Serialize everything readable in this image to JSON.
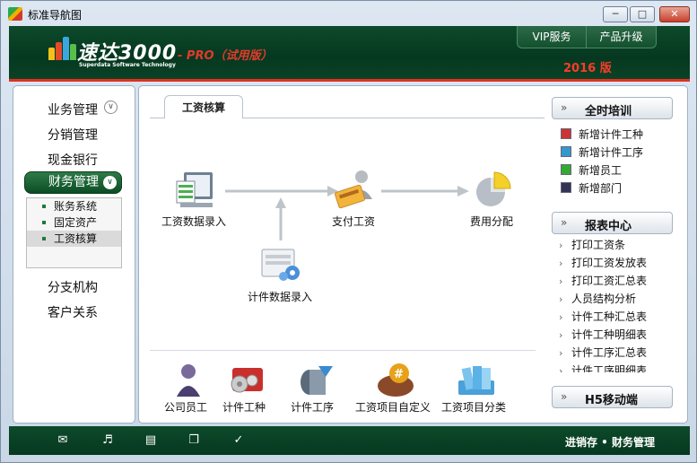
{
  "window": {
    "title": "标准导航图"
  },
  "header": {
    "logo_cn": "速达3000",
    "logo_sub": "Superdata Software Technology",
    "logo_pro": "- PRO（试用版）",
    "tabs": [
      "VIP服务",
      "产品升级"
    ],
    "year": "2016 版"
  },
  "sidebar": {
    "items_top": [
      "业务管理",
      "分销管理",
      "现金银行"
    ],
    "active": "财务管理",
    "sub_items": [
      "账务系统",
      "固定资产",
      "工资核算"
    ],
    "items_bottom": [
      "分支机构",
      "客户关系"
    ]
  },
  "main": {
    "tab": "工资核算",
    "flow": {
      "salary_entry": "工资数据录入",
      "pay_salary": "支付工资",
      "cost_allocation": "费用分配",
      "piece_entry": "计件数据录入"
    },
    "bottom": [
      "公司员工",
      "计件工种",
      "计件工序",
      "工资项目自定义",
      "工资项目分类"
    ]
  },
  "right": {
    "training": {
      "title": "全时培训",
      "items": [
        "新增计件工种",
        "新增计件工序",
        "新增员工",
        "新增部门"
      ]
    },
    "reports": {
      "title": "报表中心",
      "items": [
        "打印工资条",
        "打印工资发放表",
        "打印工资汇总表",
        "人员结构分析",
        "计件工种汇总表",
        "计件工种明细表",
        "计件工序汇总表",
        "计件工序明细表"
      ]
    },
    "h5": {
      "title": "H5移动端"
    },
    "arrow": "»"
  },
  "footer": {
    "text": "进销存 • 财务管理"
  },
  "colors": {
    "brand_green": "#063820",
    "accent_red": "#e03020"
  }
}
